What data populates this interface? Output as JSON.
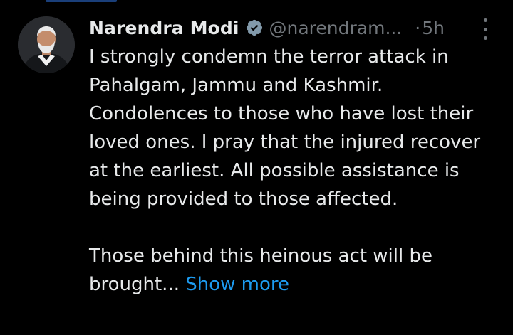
{
  "author": {
    "name": "Narendra Modi",
    "handle": "@narendram...",
    "verified": true
  },
  "meta": {
    "separator": "·",
    "timestamp": "5h"
  },
  "tweet": {
    "paragraph_1": "I strongly condemn the terror attack in Pahalgam, Jammu and Kashmir. Condolences to those who have lost their loved ones. I pray that the injured recover at the earliest. All possible assistance is being provided to those affected.",
    "paragraph_2": "Those behind this heinous act will be brought...",
    "show_more_label": "Show more"
  },
  "icons": {
    "verified": "verified-badge-icon",
    "more": "more-options-icon"
  },
  "colors": {
    "background": "#000000",
    "text": "#e7e9ea",
    "muted": "#71767b",
    "link": "#1d9bf0"
  }
}
